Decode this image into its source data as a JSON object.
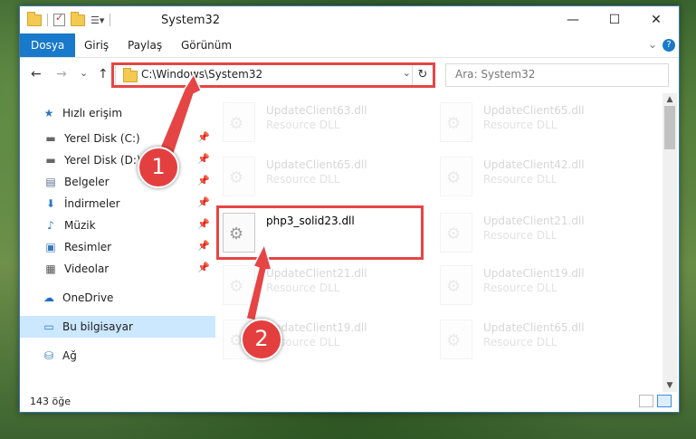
{
  "window": {
    "title": "System32",
    "minimize": "—",
    "maximize": "☐",
    "close": "✕"
  },
  "ribbon": {
    "tabs": [
      "Dosya",
      "Giriş",
      "Paylaş",
      "Görünüm"
    ],
    "expand": "⌄",
    "help": "?"
  },
  "nav": {
    "back": "←",
    "forward": "→",
    "recent": "⌄",
    "up": "↑"
  },
  "address": {
    "path": "C:\\Windows\\System32",
    "dropdown": "⌄",
    "refresh": "↻"
  },
  "search": {
    "placeholder": "Ara: System32"
  },
  "sidebar": {
    "items": [
      {
        "label": "Hızlı erişim",
        "icon": "star-icon",
        "glyph": "★",
        "color": "#2b78c5",
        "pinned": false
      },
      {
        "label": "Yerel Disk (C:)",
        "icon": "drive-icon",
        "glyph": "▬",
        "color": "#666",
        "pinned": true
      },
      {
        "label": "Yerel Disk (D:)",
        "icon": "drive-icon",
        "glyph": "▬",
        "color": "#666",
        "pinned": true
      },
      {
        "label": "Belgeler",
        "icon": "documents-icon",
        "glyph": "▤",
        "color": "#5a6f8a",
        "pinned": true
      },
      {
        "label": "İndirmeler",
        "icon": "downloads-icon",
        "glyph": "⬇",
        "color": "#2b78c5",
        "pinned": true
      },
      {
        "label": "Müzik",
        "icon": "music-icon",
        "glyph": "♪",
        "color": "#2b78c5",
        "pinned": true
      },
      {
        "label": "Resimler",
        "icon": "pictures-icon",
        "glyph": "▣",
        "color": "#3b7ab8",
        "pinned": true
      },
      {
        "label": "Videolar",
        "icon": "videos-icon",
        "glyph": "▦",
        "color": "#555",
        "pinned": true
      },
      {
        "label": "OneDrive",
        "icon": "onedrive-icon",
        "glyph": "☁",
        "color": "#1f6fc5",
        "pinned": false
      },
      {
        "label": "Bu bilgisayar",
        "icon": "computer-icon",
        "glyph": "▭",
        "color": "#2b78c5",
        "pinned": false
      },
      {
        "label": "Ağ",
        "icon": "network-icon",
        "glyph": "⛁",
        "color": "#2b78c5",
        "pinned": false
      }
    ]
  },
  "files": [
    {
      "name": "UpdateClient63.dll",
      "desc": "Resource DLL"
    },
    {
      "name": "UpdateClient65.dll",
      "desc": "Resource DLL"
    },
    {
      "name": "UpdateClient65.dll",
      "desc": "Resource DLL"
    },
    {
      "name": "UpdateClient42.dll",
      "desc": "Resource DLL"
    },
    {
      "name": "php3_solid23.dll",
      "desc": ""
    },
    {
      "name": "UpdateClient21.dll",
      "desc": "Resource DLL"
    },
    {
      "name": "UpdateClient21.dll",
      "desc": "Resource DLL"
    },
    {
      "name": "UpdateClient19.dll",
      "desc": "Resource DLL"
    },
    {
      "name": "UpdateClient19.dll",
      "desc": "Resource DLL"
    },
    {
      "name": "UpdateClient65.dll",
      "desc": "Resource DLL"
    }
  ],
  "status": {
    "count": "143 öğe"
  },
  "markers": {
    "one": "1",
    "two": "2"
  },
  "colors": {
    "accent": "#1979ca",
    "highlight_box": "#e64545",
    "selected_nav": "#cce8ff"
  }
}
